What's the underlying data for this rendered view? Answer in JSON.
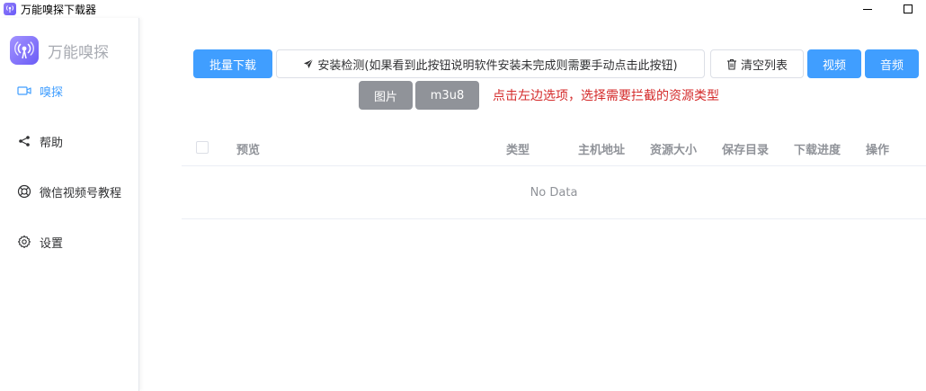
{
  "window": {
    "title": "万能嗅探下载器",
    "min_icon": "minimize-icon",
    "max_icon": "maximize-icon"
  },
  "sidebar": {
    "logo_text": "万能嗅探",
    "items": [
      {
        "label": "嗅探",
        "icon": "video-camera-icon",
        "active": true
      },
      {
        "label": "帮助",
        "icon": "share-icon",
        "active": false
      },
      {
        "label": "微信视频号教程",
        "icon": "lifebuoy-icon",
        "active": false
      },
      {
        "label": "设置",
        "icon": "gear-icon",
        "active": false
      }
    ]
  },
  "toolbar": {
    "batch_download": "批量下载",
    "install_check": "安装检测(如果看到此按钮说明软件安装未完成则需要手动点击此按钮)",
    "clear_list": "清空列表",
    "video": "视频",
    "audio": "音频",
    "image": "图片",
    "m3u8": "m3u8"
  },
  "hint": "点击左边选项，选择需要拦截的资源类型",
  "table": {
    "columns": [
      "预览",
      "类型",
      "主机地址",
      "资源大小",
      "保存目录",
      "下载进度",
      "操作"
    ],
    "empty_text": "No Data"
  },
  "colors": {
    "primary": "#409eff",
    "info": "#909399",
    "hint": "#d42b2b"
  }
}
